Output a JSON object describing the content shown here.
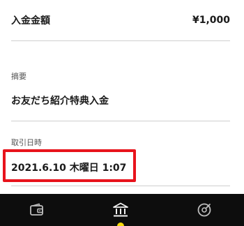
{
  "amount": {
    "label": "入金金額",
    "value": "¥1,000"
  },
  "summary": {
    "label": "摘要",
    "value": "お友だち紹介特典入金"
  },
  "transaction_date": {
    "label": "取引日時",
    "value": "2021.6.10 木曜日 1:07"
  },
  "highlight_color": "#e8131c",
  "tabbar": {
    "background": "#0d0d0d",
    "active_indicator_color": "#f5d90a",
    "tabs": [
      {
        "icon": "wallet-icon"
      },
      {
        "icon": "bank-icon",
        "active": true
      },
      {
        "icon": "history-icon"
      }
    ]
  }
}
